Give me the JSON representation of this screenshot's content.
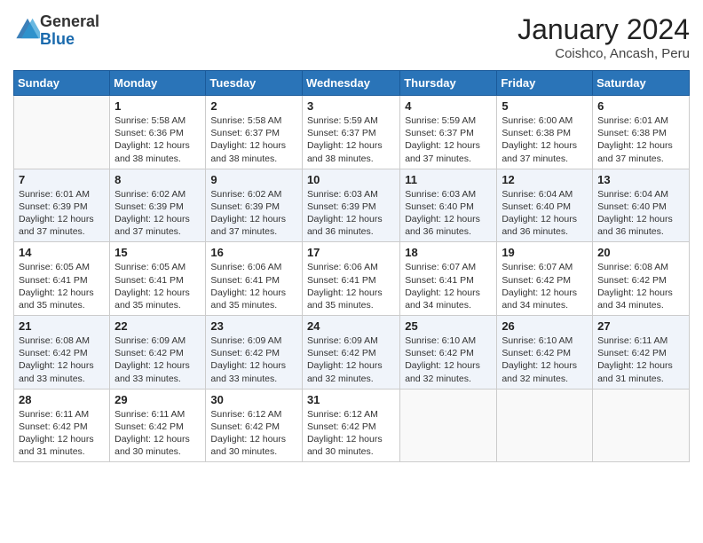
{
  "logo": {
    "general": "General",
    "blue": "Blue"
  },
  "header": {
    "title": "January 2024",
    "subtitle": "Coishco, Ancash, Peru"
  },
  "weekdays": [
    "Sunday",
    "Monday",
    "Tuesday",
    "Wednesday",
    "Thursday",
    "Friday",
    "Saturday"
  ],
  "weeks": [
    [
      {
        "day": "",
        "empty": true
      },
      {
        "day": "1",
        "sunrise": "5:58 AM",
        "sunset": "6:36 PM",
        "daylight": "12 hours and 38 minutes."
      },
      {
        "day": "2",
        "sunrise": "5:58 AM",
        "sunset": "6:37 PM",
        "daylight": "12 hours and 38 minutes."
      },
      {
        "day": "3",
        "sunrise": "5:59 AM",
        "sunset": "6:37 PM",
        "daylight": "12 hours and 38 minutes."
      },
      {
        "day": "4",
        "sunrise": "5:59 AM",
        "sunset": "6:37 PM",
        "daylight": "12 hours and 37 minutes."
      },
      {
        "day": "5",
        "sunrise": "6:00 AM",
        "sunset": "6:38 PM",
        "daylight": "12 hours and 37 minutes."
      },
      {
        "day": "6",
        "sunrise": "6:01 AM",
        "sunset": "6:38 PM",
        "daylight": "12 hours and 37 minutes."
      }
    ],
    [
      {
        "day": "7",
        "sunrise": "6:01 AM",
        "sunset": "6:39 PM",
        "daylight": "12 hours and 37 minutes."
      },
      {
        "day": "8",
        "sunrise": "6:02 AM",
        "sunset": "6:39 PM",
        "daylight": "12 hours and 37 minutes."
      },
      {
        "day": "9",
        "sunrise": "6:02 AM",
        "sunset": "6:39 PM",
        "daylight": "12 hours and 37 minutes."
      },
      {
        "day": "10",
        "sunrise": "6:03 AM",
        "sunset": "6:39 PM",
        "daylight": "12 hours and 36 minutes."
      },
      {
        "day": "11",
        "sunrise": "6:03 AM",
        "sunset": "6:40 PM",
        "daylight": "12 hours and 36 minutes."
      },
      {
        "day": "12",
        "sunrise": "6:04 AM",
        "sunset": "6:40 PM",
        "daylight": "12 hours and 36 minutes."
      },
      {
        "day": "13",
        "sunrise": "6:04 AM",
        "sunset": "6:40 PM",
        "daylight": "12 hours and 36 minutes."
      }
    ],
    [
      {
        "day": "14",
        "sunrise": "6:05 AM",
        "sunset": "6:41 PM",
        "daylight": "12 hours and 35 minutes."
      },
      {
        "day": "15",
        "sunrise": "6:05 AM",
        "sunset": "6:41 PM",
        "daylight": "12 hours and 35 minutes."
      },
      {
        "day": "16",
        "sunrise": "6:06 AM",
        "sunset": "6:41 PM",
        "daylight": "12 hours and 35 minutes."
      },
      {
        "day": "17",
        "sunrise": "6:06 AM",
        "sunset": "6:41 PM",
        "daylight": "12 hours and 35 minutes."
      },
      {
        "day": "18",
        "sunrise": "6:07 AM",
        "sunset": "6:41 PM",
        "daylight": "12 hours and 34 minutes."
      },
      {
        "day": "19",
        "sunrise": "6:07 AM",
        "sunset": "6:42 PM",
        "daylight": "12 hours and 34 minutes."
      },
      {
        "day": "20",
        "sunrise": "6:08 AM",
        "sunset": "6:42 PM",
        "daylight": "12 hours and 34 minutes."
      }
    ],
    [
      {
        "day": "21",
        "sunrise": "6:08 AM",
        "sunset": "6:42 PM",
        "daylight": "12 hours and 33 minutes."
      },
      {
        "day": "22",
        "sunrise": "6:09 AM",
        "sunset": "6:42 PM",
        "daylight": "12 hours and 33 minutes."
      },
      {
        "day": "23",
        "sunrise": "6:09 AM",
        "sunset": "6:42 PM",
        "daylight": "12 hours and 33 minutes."
      },
      {
        "day": "24",
        "sunrise": "6:09 AM",
        "sunset": "6:42 PM",
        "daylight": "12 hours and 32 minutes."
      },
      {
        "day": "25",
        "sunrise": "6:10 AM",
        "sunset": "6:42 PM",
        "daylight": "12 hours and 32 minutes."
      },
      {
        "day": "26",
        "sunrise": "6:10 AM",
        "sunset": "6:42 PM",
        "daylight": "12 hours and 32 minutes."
      },
      {
        "day": "27",
        "sunrise": "6:11 AM",
        "sunset": "6:42 PM",
        "daylight": "12 hours and 31 minutes."
      }
    ],
    [
      {
        "day": "28",
        "sunrise": "6:11 AM",
        "sunset": "6:42 PM",
        "daylight": "12 hours and 31 minutes."
      },
      {
        "day": "29",
        "sunrise": "6:11 AM",
        "sunset": "6:42 PM",
        "daylight": "12 hours and 30 minutes."
      },
      {
        "day": "30",
        "sunrise": "6:12 AM",
        "sunset": "6:42 PM",
        "daylight": "12 hours and 30 minutes."
      },
      {
        "day": "31",
        "sunrise": "6:12 AM",
        "sunset": "6:42 PM",
        "daylight": "12 hours and 30 minutes."
      },
      {
        "day": "",
        "empty": true
      },
      {
        "day": "",
        "empty": true
      },
      {
        "day": "",
        "empty": true
      }
    ]
  ]
}
